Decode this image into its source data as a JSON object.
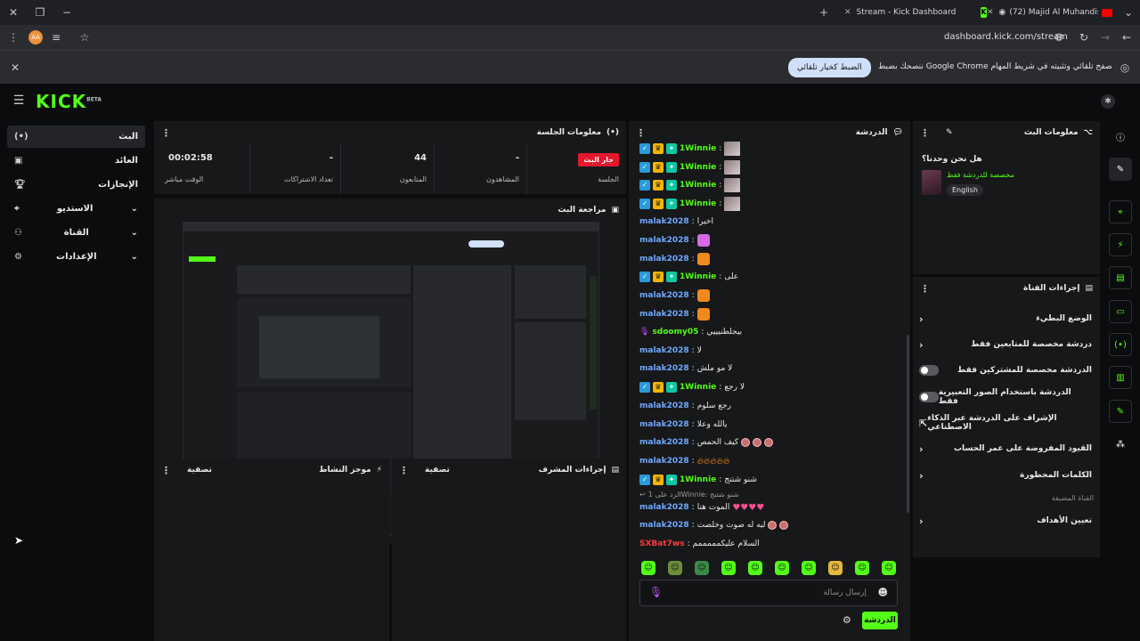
{
  "browser": {
    "tab_active_title": "Stream - Kick Dashboard",
    "tab_other_title": "(72) Majid Al Muhandis - A...",
    "url": "dashboard.kick.com/stream",
    "profile_initials": "AA",
    "infobar_text": "ننصحك بضبط Google Chrome كمتصفح تلقائي وتثبيته في شريط المهام",
    "infobar_button": "الضبط كخيار تلقائي"
  },
  "app": {
    "logo": "KICK",
    "logo_sup": "BETA"
  },
  "sidebar": {
    "items": [
      {
        "label": "البث",
        "icon": "broadcast-icon"
      },
      {
        "label": "العائد",
        "icon": "wallet-icon"
      },
      {
        "label": "الإنجازات",
        "icon": "trophy-icon"
      },
      {
        "label": "الاستديو",
        "icon": "studio-icon"
      },
      {
        "label": "القناة",
        "icon": "users-icon"
      },
      {
        "label": "الإعدادات",
        "icon": "gear-icon"
      }
    ]
  },
  "session": {
    "title": "معلومات الجلسة",
    "live_badge": "جار البث",
    "stats": [
      {
        "label": "الجلسة",
        "value": ""
      },
      {
        "label": "المشاهدون",
        "value": "-"
      },
      {
        "label": "المتابعون",
        "value": "44"
      },
      {
        "label": "تعداد الاشتراكات",
        "value": "-"
      },
      {
        "label": "الوقت مباشر",
        "value": "00:02:58"
      }
    ]
  },
  "preview": {
    "title": "مراجعة البث"
  },
  "activity": {
    "title": "موجز النشاط",
    "filter": "تصفية"
  },
  "mod_actions": {
    "title": "إجراءات المشرف",
    "filter": "تصفية"
  },
  "chat": {
    "title": "الدردشة",
    "messages": [
      {
        "user": "1Winnie",
        "text": ""
      },
      {
        "user": "1Winnie",
        "text": ""
      },
      {
        "user": "1Winnie",
        "text": ""
      },
      {
        "user": "1Winnie",
        "text": ""
      },
      {
        "user": "malak2028",
        "text": "اخيرا"
      },
      {
        "user": "malak2028",
        "text": ""
      },
      {
        "user": "malak2028",
        "text": ""
      },
      {
        "user": "1Winnie",
        "text": "على"
      },
      {
        "user": "malak2028",
        "text": ""
      },
      {
        "user": "malak2028",
        "text": ""
      },
      {
        "user": "sdoomy05",
        "text": "بيجلطنيييي"
      },
      {
        "user": "malak2028",
        "text": "لا"
      },
      {
        "user": "malak2028",
        "text": "لا مو ملش"
      },
      {
        "user": "1Winnie",
        "text": "لا رجع"
      },
      {
        "user": "malak2028",
        "text": "رجع سلوم"
      },
      {
        "user": "malak2028",
        "text": "يالله وعلا"
      },
      {
        "user": "malak2028",
        "text": "كيف الحمص"
      },
      {
        "user": "malak2028",
        "text": ""
      },
      {
        "user": "1Winnie",
        "text": "شنو شتنج"
      },
      {
        "user": "malak2028",
        "text": "الموت هنا"
      },
      {
        "user": "malak2028",
        "text": "ليه له صوت وخلصت"
      },
      {
        "user": "SXBat7ws",
        "text": "السلام عليكمممممم"
      }
    ],
    "reply_to": "الرد على 1Winnie: شنو شتنج",
    "input_placeholder": "إرسال رسالة",
    "send_button": "الدردشة"
  },
  "stream_info": {
    "title": "معلومات البث",
    "stream_title": "هل نحن وحدنا؟",
    "category": "مخصصة للدردشة فقط",
    "language": "English"
  },
  "channel_actions": {
    "title": "إجراءات القناة",
    "rows": [
      {
        "label": "الوضع البطيء",
        "control": "chevron"
      },
      {
        "label": "دردشة مخصصة للمتابعين فقط",
        "control": "chevron"
      },
      {
        "label": "الدردشة مخصصة للمشتركين فقط",
        "control": "toggle"
      },
      {
        "label": "الدردشة باستخدام الصور التعبيرية فقط",
        "control": "toggle"
      },
      {
        "label": "الإشراف على الدردشة عبر الذكاء الاصطناعي",
        "control": "external"
      },
      {
        "label": "القيود المفروضة على عمر الحساب",
        "control": "chevron"
      },
      {
        "label": "الكلمات المحظورة",
        "control": "chevron"
      }
    ],
    "section_label": "القناة المضيفة",
    "host_row": "تعيين الأهداف"
  },
  "colors": {
    "accent": "#53fc18",
    "live": "#e3172d",
    "username_blue": "#6ea8ff",
    "username_green": "#53fc18",
    "username_red": "#ff3b3b"
  }
}
